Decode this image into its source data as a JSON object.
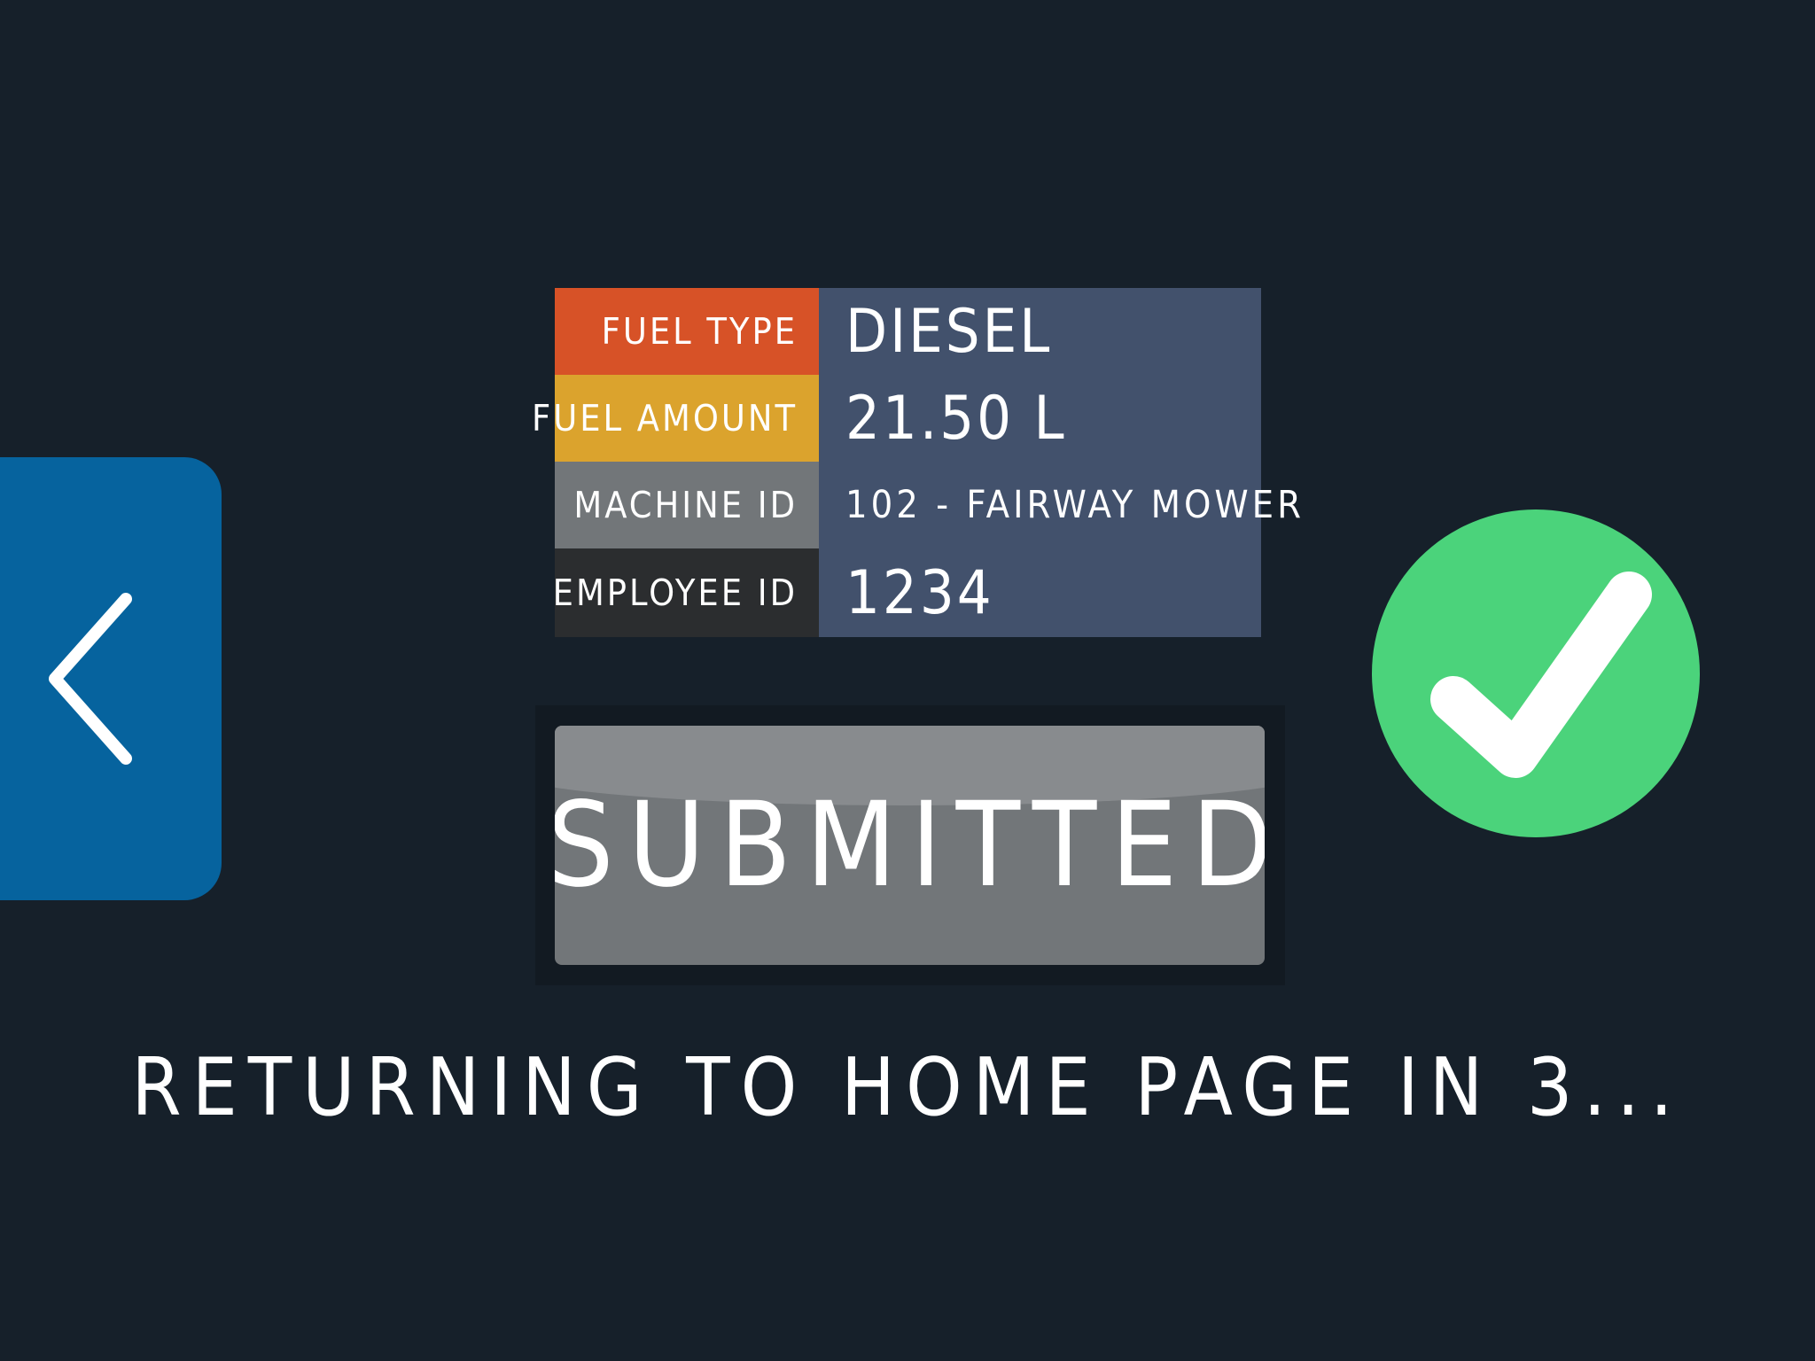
{
  "back_button": {
    "icon": "chevron-left-icon"
  },
  "summary": {
    "rows": [
      {
        "label": "FUEL TYPE",
        "value": "DIESEL",
        "color": "#d75227"
      },
      {
        "label": "FUEL AMOUNT",
        "value": "21.50 L",
        "color": "#dba32d"
      },
      {
        "label": "MACHINE ID",
        "value": "102 - FAIRWAY MOWER",
        "color": "#727679"
      },
      {
        "label": "EMPLOYEE ID",
        "value": "1234",
        "color": "#2b2d2f"
      }
    ],
    "value_panel_color": "#42516c"
  },
  "submit": {
    "label": "SUBMITTED"
  },
  "status": {
    "icon": "check-circle-icon",
    "color": "#4bd37b"
  },
  "countdown": {
    "text": "RETURNING TO HOME PAGE IN 3..."
  }
}
